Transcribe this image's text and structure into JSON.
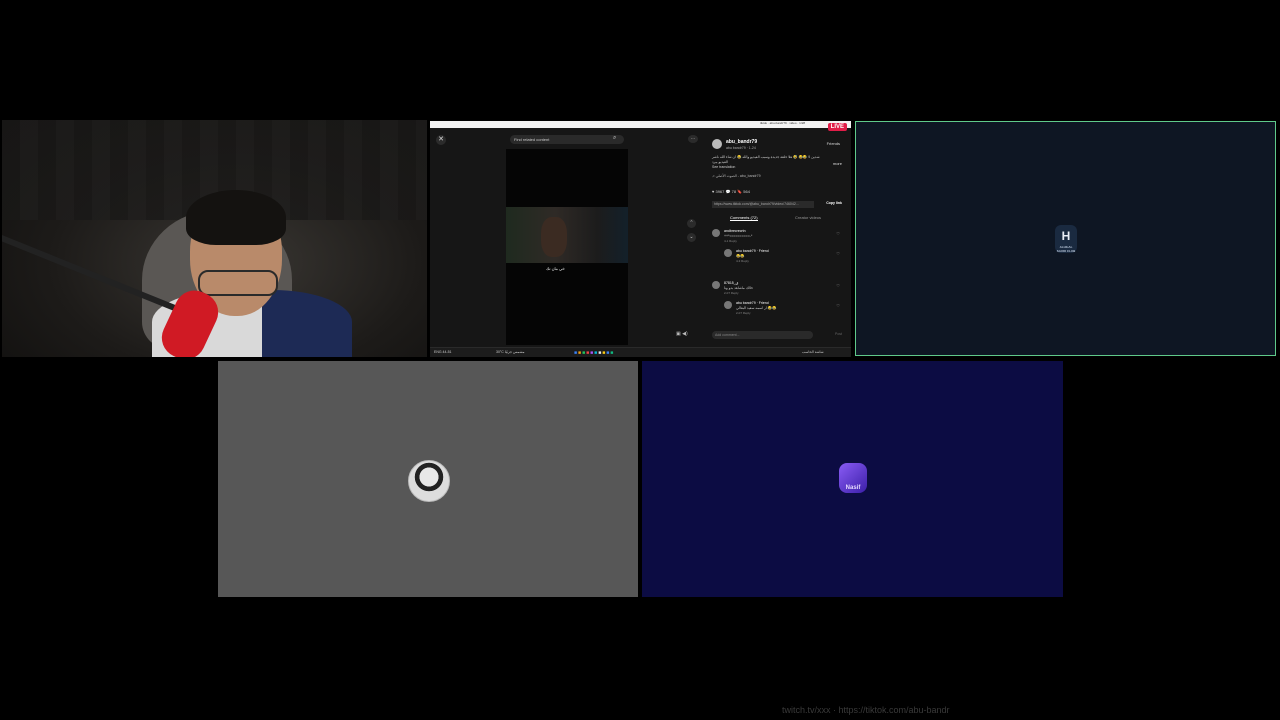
{
  "screen_share": {
    "live_badge": "LIVE",
    "browser_url": "tiktok · abu-bandr79 · video · 1/28",
    "close": "✕",
    "search_placeholder": "Find related content",
    "video_caption": "خي مان تك",
    "post": {
      "author": "abu_bandr79",
      "author_sub": "abu bandr79 · 1-24",
      "friends_label": "Friends",
      "description": "شدين لا 😂😂 🤣 هلا حلقة جديدة وسبب الفيديو والله 😂 ان شاء الله ناشر الفيديو بيرد",
      "see_translation": "See translation",
      "more_label": "more",
      "music": "♫ الصوت الأصلي - abu_bandr79",
      "actions": "♥ 3967   💬 78   🔖 564",
      "link": "https://www.tiktok.com/@abu_bandr79/video/746042...",
      "copy_link": "Copy link",
      "tab_comments": "Comments (72)",
      "tab_creator": "Creator videos"
    },
    "comments": [
      {
        "name": "andbrecrecrtn",
        "text": "++*==========-*",
        "meta": "4-1   Reply"
      },
      {
        "name": "abu bandr79 · Friend",
        "text": "😂😂",
        "meta": "4-3   Reply"
      },
      {
        "name": "ٯ_87815",
        "text": "خالك ماشاهد بدو ونا",
        "meta": "2-07   Reply"
      },
      {
        "name": "abu bandr79 · Friend",
        "text": "ار اسمه سعيد البقالي 😂😂",
        "meta": "2-07   Reply"
      }
    ],
    "add_comment_placeholder": "Add comment...",
    "post_label": "Post",
    "taskbar": {
      "left": "ENG  44-51",
      "weather": "30°C  مشمس جزئيًا",
      "right": "شاشة الحاسب"
    }
  },
  "tiles": {
    "alhilal": {
      "logo_text": "H",
      "caption": "ALHILAL SAUDI CLUB"
    },
    "gray": {
      "avatar": "anime-avatar"
    },
    "blue": {
      "badge": "Nasif"
    }
  },
  "watermark": "twitch.tv/xxx · https://tiktok.com/abu-bandr",
  "colors": {
    "alhilal_border": "#5fc98a",
    "alhilal_bg": "#0e1623",
    "gray_bg": "#575757",
    "blue_bg": "#0c0c43",
    "live_red": "#e11d48"
  }
}
